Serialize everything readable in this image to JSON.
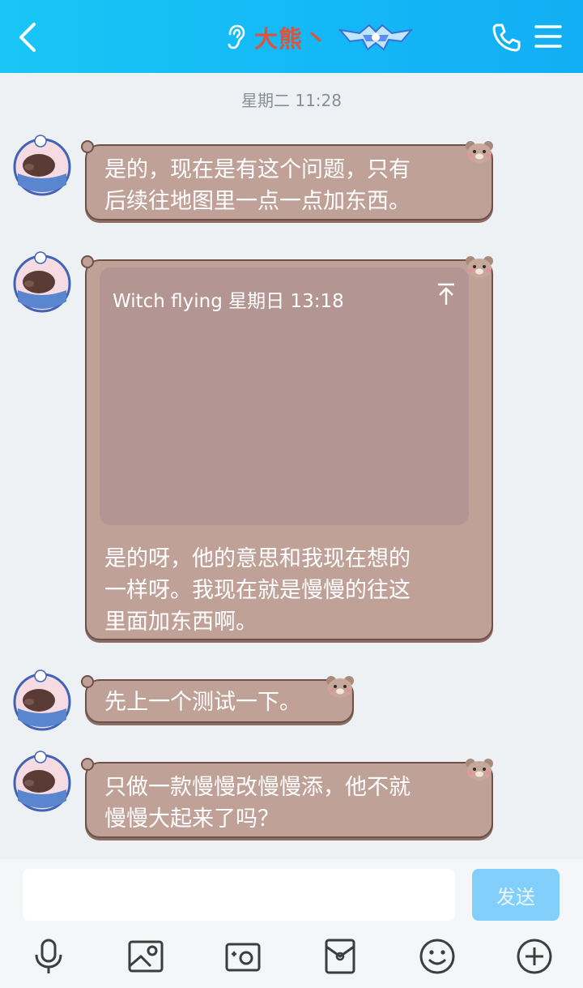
{
  "header": {
    "title": "大熊",
    "title_mark": "丶",
    "accent": "#14b8f6",
    "title_color": "#e0523a",
    "icons": [
      "back-arrow-icon",
      "ear-icon",
      "vip-badge-icon",
      "phone-icon",
      "menu-icon"
    ]
  },
  "chat": {
    "timestamp": "星期二 11:28",
    "messages": [
      {
        "text_line1": "是的，现在是有这个问题，只有",
        "text_line2": "后续往地图里一点一点加东西。"
      },
      {
        "quote_author_time": "Witch flying 星期日 13:18",
        "text_line1": "是的呀，他的意思和我现在想的",
        "text_line2": "一样呀。我现在就是慢慢的往这",
        "text_line3": "里面加东西啊。"
      },
      {
        "text_line1": "先上一个测试一下。"
      },
      {
        "text_line1": "只做一款慢慢改慢慢添，他不就",
        "text_line2": "慢慢大起来了吗？"
      }
    ],
    "bubble_color": "#c0a198"
  },
  "input_bar": {
    "placeholder": "",
    "send_label": "发送",
    "tools": [
      "microphone-icon",
      "image-icon",
      "camera-icon",
      "red-packet-icon",
      "emoji-icon",
      "plus-icon"
    ]
  }
}
